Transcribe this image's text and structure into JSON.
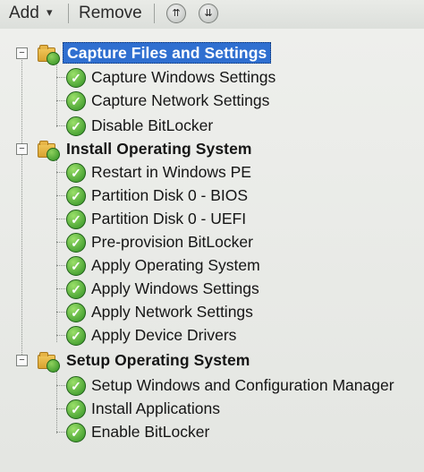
{
  "toolbar": {
    "add_label": "Add",
    "add_caret": "▾",
    "remove_label": "Remove",
    "move_up_icon": "⇈",
    "move_down_icon": "⇊"
  },
  "tree": {
    "groups": [
      {
        "label": "Capture Files and Settings",
        "expander": "−",
        "selected": true,
        "items": [
          {
            "label": "Capture Windows Settings"
          },
          {
            "label": "Capture Network Settings"
          },
          {
            "label": "Disable BitLocker"
          }
        ]
      },
      {
        "label": "Install Operating System",
        "expander": "−",
        "selected": false,
        "items": [
          {
            "label": "Restart in Windows PE"
          },
          {
            "label": "Partition Disk 0 - BIOS"
          },
          {
            "label": "Partition Disk 0 - UEFI"
          },
          {
            "label": "Pre-provision BitLocker"
          },
          {
            "label": "Apply Operating System"
          },
          {
            "label": "Apply Windows Settings"
          },
          {
            "label": "Apply Network Settings"
          },
          {
            "label": "Apply Device Drivers"
          }
        ]
      },
      {
        "label": "Setup Operating System",
        "expander": "−",
        "selected": false,
        "items": [
          {
            "label": "Setup Windows and Configuration Manager"
          },
          {
            "label": "Install Applications"
          },
          {
            "label": "Enable BitLocker"
          }
        ]
      }
    ]
  },
  "colors": {
    "selection": "#2f6fd0",
    "check_green": "#2f8f22",
    "folder": "#d8a22f"
  }
}
